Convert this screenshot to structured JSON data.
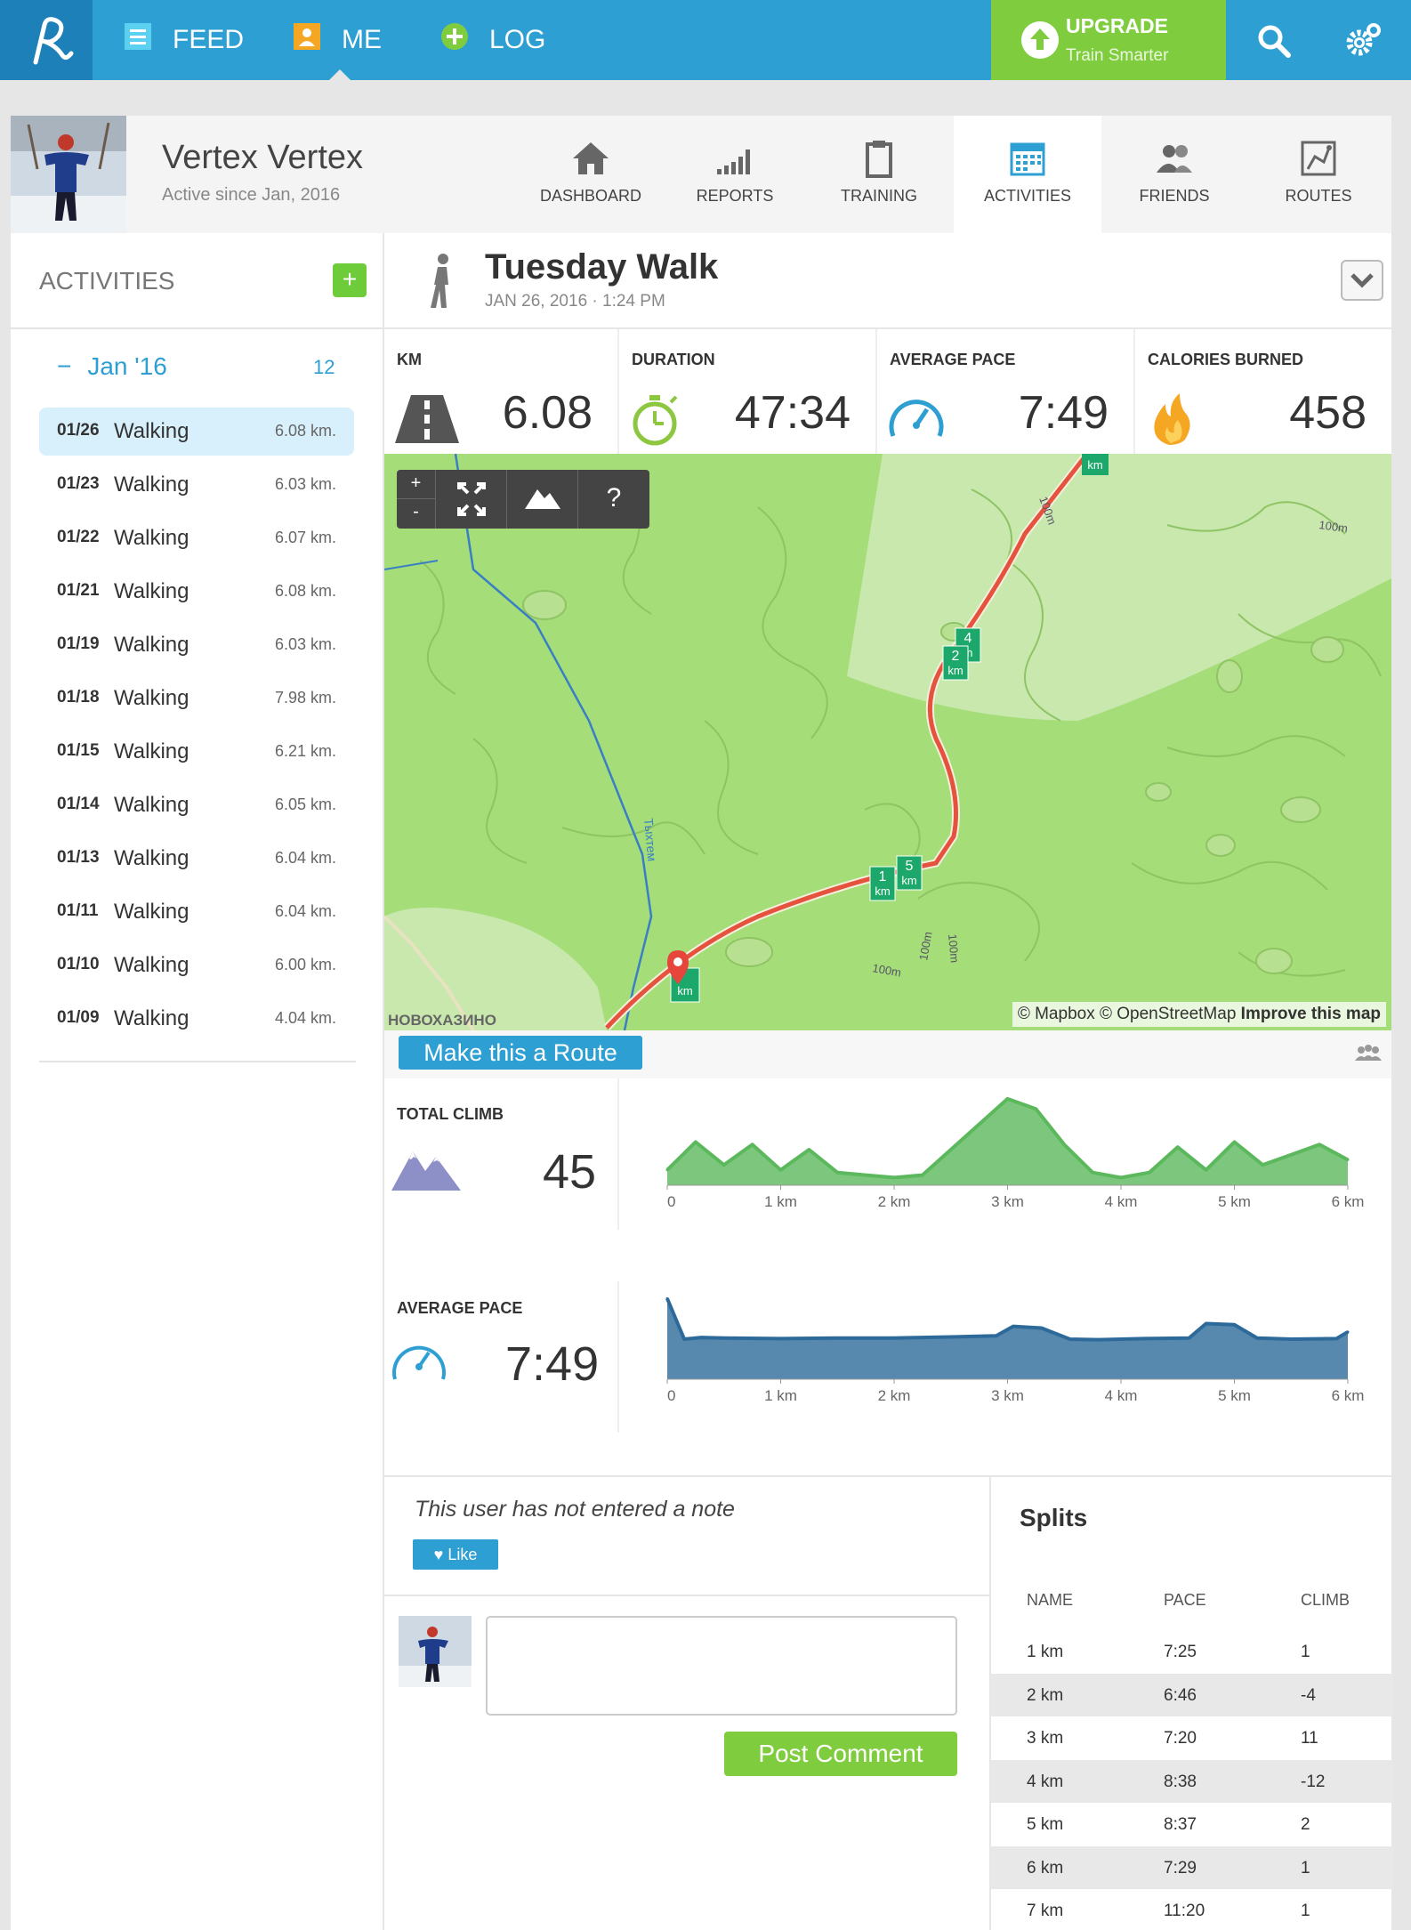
{
  "topnav": {
    "items": [
      {
        "label": "FEED",
        "icon": "feed-icon"
      },
      {
        "label": "ME",
        "icon": "person-icon"
      },
      {
        "label": "LOG",
        "icon": "plus-circle-icon"
      }
    ],
    "upgrade_title": "UPGRADE",
    "upgrade_subtitle": "Train Smarter"
  },
  "profile": {
    "name": "Vertex Vertex",
    "since": "Active since Jan, 2016",
    "tabs": [
      {
        "label": "DASHBOARD",
        "icon": "home-icon"
      },
      {
        "label": "REPORTS",
        "icon": "bars-icon"
      },
      {
        "label": "TRAINING",
        "icon": "clipboard-icon"
      },
      {
        "label": "ACTIVITIES",
        "icon": "calendar-icon"
      },
      {
        "label": "FRIENDS",
        "icon": "friends-icon"
      },
      {
        "label": "ROUTES",
        "icon": "route-icon"
      }
    ]
  },
  "sidebar": {
    "title": "ACTIVITIES",
    "add": "+",
    "month_toggle": "−",
    "month": "Jan '16",
    "count": "12",
    "activities": [
      {
        "date": "01/26",
        "type": "Walking",
        "km": "6.08 km."
      },
      {
        "date": "01/23",
        "type": "Walking",
        "km": "6.03 km."
      },
      {
        "date": "01/22",
        "type": "Walking",
        "km": "6.07 km."
      },
      {
        "date": "01/21",
        "type": "Walking",
        "km": "6.08 km."
      },
      {
        "date": "01/19",
        "type": "Walking",
        "km": "6.03 km."
      },
      {
        "date": "01/18",
        "type": "Walking",
        "km": "7.98 km."
      },
      {
        "date": "01/15",
        "type": "Walking",
        "km": "6.21 km."
      },
      {
        "date": "01/14",
        "type": "Walking",
        "km": "6.05 km."
      },
      {
        "date": "01/13",
        "type": "Walking",
        "km": "6.04 km."
      },
      {
        "date": "01/11",
        "type": "Walking",
        "km": "6.04 km."
      },
      {
        "date": "01/10",
        "type": "Walking",
        "km": "6.00 km."
      },
      {
        "date": "01/09",
        "type": "Walking",
        "km": "4.04 km."
      }
    ]
  },
  "activity": {
    "title": "Tuesday Walk",
    "date": "JAN 26, 2016  ·  1:24 PM",
    "stats": [
      {
        "label": "KM",
        "value": "6.08"
      },
      {
        "label": "DURATION",
        "value": "47:34"
      },
      {
        "label": "AVERAGE PACE",
        "value": "7:49"
      },
      {
        "label": "CALORIES BURNED",
        "value": "458"
      }
    ]
  },
  "map": {
    "controls": {
      "zoom_in": "+",
      "zoom_out": "-",
      "help": "?"
    },
    "credit": "© Mapbox © OpenStreetMap",
    "improve": "Improve this map",
    "place": "НОВОХАЗИНО",
    "river": "Тыхтем",
    "contours": [
      "100m",
      "100m",
      "100m",
      "100m",
      "100m"
    ],
    "markers": [
      {
        "num": "",
        "unit": "km"
      },
      {
        "num": "1",
        "unit": "km"
      },
      {
        "num": "5",
        "unit": "km"
      },
      {
        "num": "2",
        "unit": "km"
      },
      {
        "num": "4",
        "unit": "m"
      },
      {
        "num": "",
        "unit": "km"
      }
    ]
  },
  "route_button": "Make this a Route",
  "climb": {
    "label": "TOTAL CLIMB",
    "value": "45"
  },
  "pace": {
    "label": "AVERAGE PACE",
    "value": "7:49"
  },
  "chart_data": [
    {
      "type": "area",
      "x": [
        0,
        0.25,
        0.5,
        0.75,
        1,
        1.25,
        1.5,
        1.75,
        2,
        2.25,
        2.5,
        2.75,
        3,
        3.25,
        3.5,
        3.75,
        4,
        4.25,
        4.5,
        4.75,
        5,
        5.25,
        5.5,
        5.75,
        6
      ],
      "values": [
        6,
        17,
        8,
        16,
        6,
        14,
        5,
        4,
        3,
        4,
        14,
        24,
        34,
        30,
        16,
        5,
        3,
        5,
        15,
        6,
        17,
        8,
        12,
        16,
        10
      ],
      "tick_labels": [
        "0",
        "1 km",
        "2 km",
        "3 km",
        "4 km",
        "5 km",
        "6 km"
      ],
      "xlim": [
        0,
        6
      ],
      "ylim": [
        0,
        35
      ],
      "color": "#5cb85c"
    },
    {
      "type": "area",
      "x": [
        0,
        0.15,
        0.3,
        0.5,
        1,
        1.5,
        2,
        2.5,
        2.9,
        3.05,
        3.3,
        3.55,
        3.8,
        4.2,
        4.6,
        4.75,
        5,
        5.2,
        5.5,
        5.9,
        6
      ],
      "values": [
        14.5,
        7.2,
        7.5,
        7.4,
        7.3,
        7.4,
        7.4,
        7.6,
        7.8,
        9.5,
        9.2,
        7.2,
        7.1,
        7.3,
        7.4,
        10.0,
        9.8,
        7.4,
        7.2,
        7.3,
        8.5
      ],
      "tick_labels": [
        "0",
        "1 km",
        "2 km",
        "3 km",
        "4 km",
        "5 km",
        "6 km"
      ],
      "xlim": [
        0,
        6
      ],
      "ylim": [
        0,
        16
      ],
      "color": "#2d6a9a"
    }
  ],
  "note": {
    "text": "This user has not entered a note",
    "like": "Like"
  },
  "comment": {
    "post": "Post Comment"
  },
  "splits": {
    "title": "Splits",
    "headers": [
      "NAME",
      "PACE",
      "CLIMB"
    ],
    "rows": [
      {
        "name": "1 km",
        "pace": "7:25",
        "climb": "1"
      },
      {
        "name": "2 km",
        "pace": "6:46",
        "climb": "-4"
      },
      {
        "name": "3 km",
        "pace": "7:20",
        "climb": "11"
      },
      {
        "name": "4 km",
        "pace": "8:38",
        "climb": "-12"
      },
      {
        "name": "5 km",
        "pace": "8:37",
        "climb": "2"
      },
      {
        "name": "6 km",
        "pace": "7:29",
        "climb": "1"
      },
      {
        "name": "7 km",
        "pace": "11:20",
        "climb": "1"
      }
    ]
  }
}
